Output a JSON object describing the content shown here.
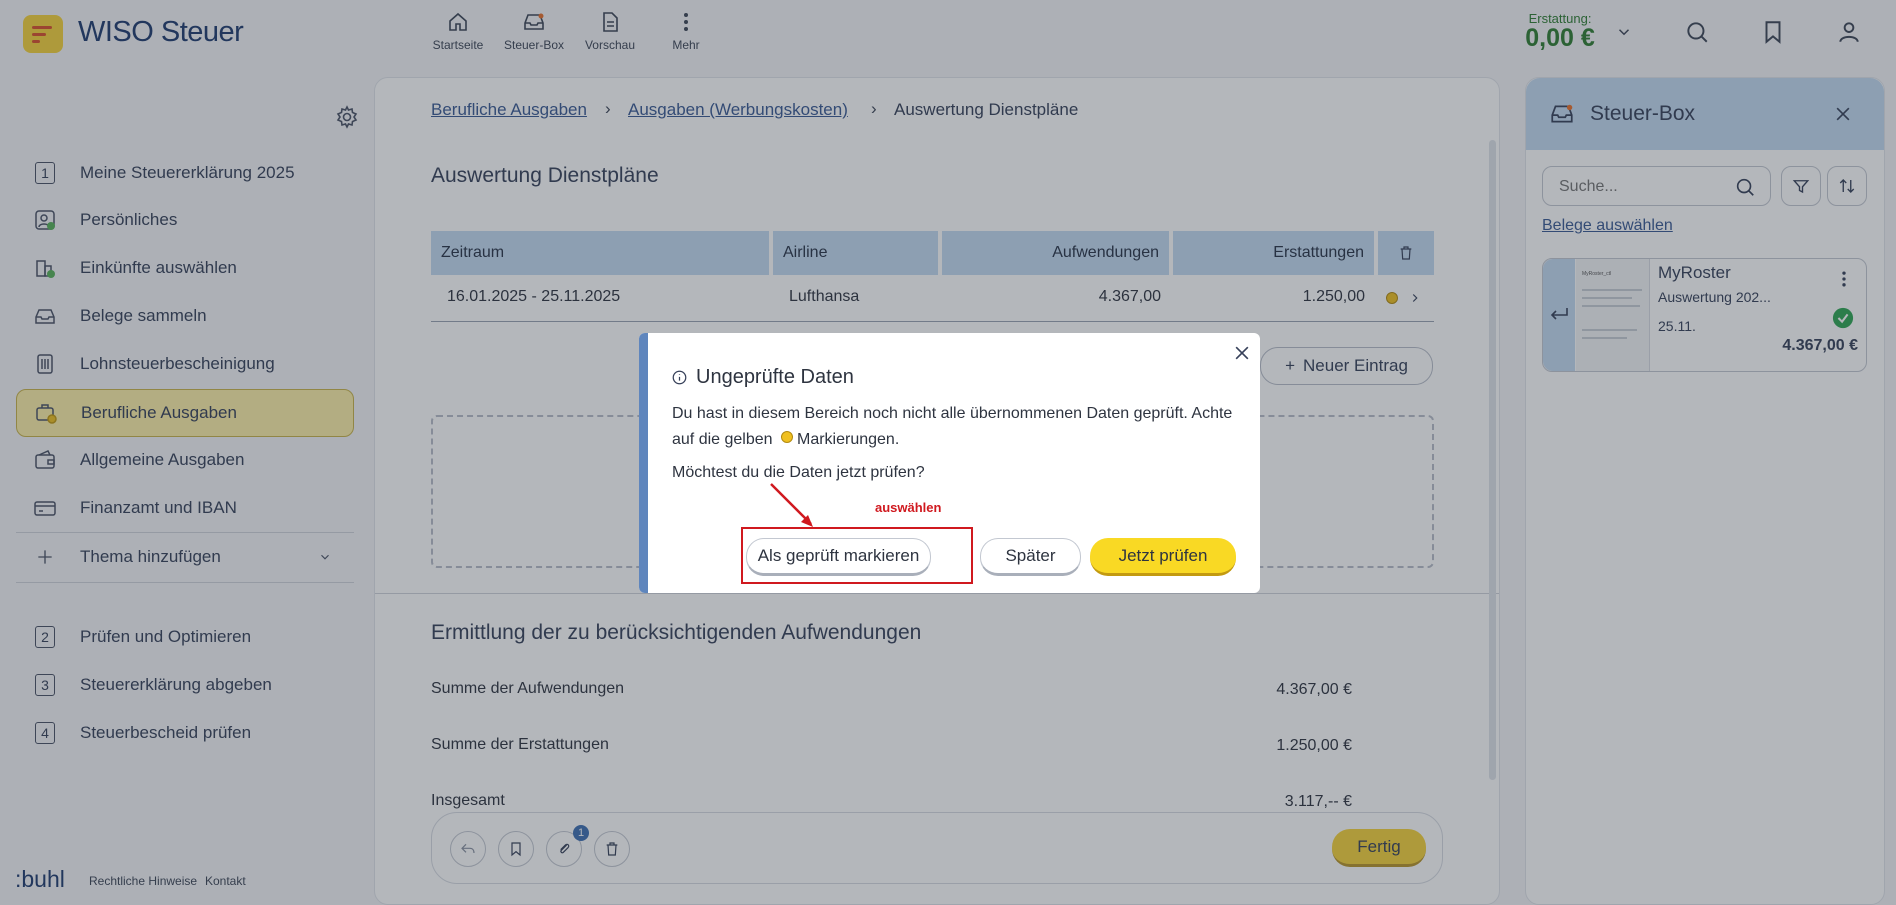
{
  "app": {
    "brand": "WISO Steuer"
  },
  "topnav": [
    {
      "label": "Startseite",
      "icon": "home-icon"
    },
    {
      "label": "Steuer-Box",
      "icon": "inbox-icon"
    },
    {
      "label": "Vorschau",
      "icon": "document-icon"
    },
    {
      "label": "Mehr",
      "icon": "more-vertical-icon"
    }
  ],
  "erstattung": {
    "label": "Erstattung:",
    "value": "0,00 €"
  },
  "sidebar": {
    "items": [
      {
        "num": "1",
        "label": "Meine Steuererklärung 2025"
      },
      {
        "label": "Persönliches",
        "icon": "person-check-icon"
      },
      {
        "label": "Einkünfte auswählen",
        "icon": "income-check-icon"
      },
      {
        "label": "Belege sammeln",
        "icon": "tray-icon"
      },
      {
        "label": "Lohnsteuerbescheinigung",
        "icon": "certificate-icon"
      },
      {
        "label": "Berufliche Ausgaben",
        "icon": "briefcase-icon"
      },
      {
        "label": "Allgemeine Ausgaben",
        "icon": "wallet-icon"
      },
      {
        "label": "Finanzamt und IBAN",
        "icon": "card-icon"
      },
      {
        "label": "Thema hinzufügen",
        "icon": "plus-icon"
      }
    ],
    "steps": [
      {
        "num": "2",
        "label": "Prüfen und Optimieren"
      },
      {
        "num": "3",
        "label": "Steuererklärung abgeben"
      },
      {
        "num": "4",
        "label": "Steuerbescheid prüfen"
      }
    ]
  },
  "footer": {
    "logo": ":buhl",
    "legal": "Rechtliche Hinweise",
    "contact": "Kontakt"
  },
  "breadcrumb": {
    "first": "Berufliche Ausgaben",
    "second": "Ausgaben (Werbungskosten)",
    "current": "Auswertung Dienstpläne"
  },
  "section_title": "Auswertung Dienstpläne",
  "table": {
    "headers": [
      "Zeitraum",
      "Airline",
      "Aufwendungen",
      "Erstattungen"
    ],
    "rows": [
      [
        "16.01.2025 - 25.11.2025",
        "Lufthansa",
        "4.367,00",
        "1.250,00"
      ]
    ]
  },
  "new_entry": "Neuer Eintrag",
  "ermittlung": {
    "title": "Ermittlung der zu berücksichtigenden Aufwendungen",
    "rows": [
      {
        "label": "Summe der Aufwendungen",
        "value": "4.367,00 €"
      },
      {
        "label": "Summe der Erstattungen",
        "value": "1.250,00 €"
      },
      {
        "label": "Insgesamt",
        "value": "3.117,-- €"
      }
    ]
  },
  "bottom_bar": {
    "badge": "1",
    "done": "Fertig"
  },
  "steuerbox": {
    "title": "Steuer-Box",
    "search_placeholder": "Suche...",
    "select_link": "Belege auswählen",
    "doc": {
      "title": "MyRoster",
      "subtitle": "Auswertung 202...",
      "date": "25.11.",
      "amount": "4.367,00 €",
      "thumb_text": "MyRoster_ctl"
    }
  },
  "modal": {
    "title": "Ungeprüfte Daten",
    "body_before": "Du hast in diesem Bereich noch nicht alle übernommenen Daten geprüft. Achte auf die gelben",
    "body_after": "Markierungen.",
    "question": "Möchtest du die Daten jetzt prüfen?",
    "btn_mark": "Als geprüft markieren",
    "btn_later": "Später",
    "btn_check": "Jetzt prüfen"
  },
  "annotation": {
    "text": "auswählen",
    "color": "#d0191f"
  },
  "colors": {
    "accent_yellow": "#f6d33b",
    "brand_blue": "#1f3b6f",
    "success": "#2e7d32",
    "table_header": "#c3daf2"
  }
}
